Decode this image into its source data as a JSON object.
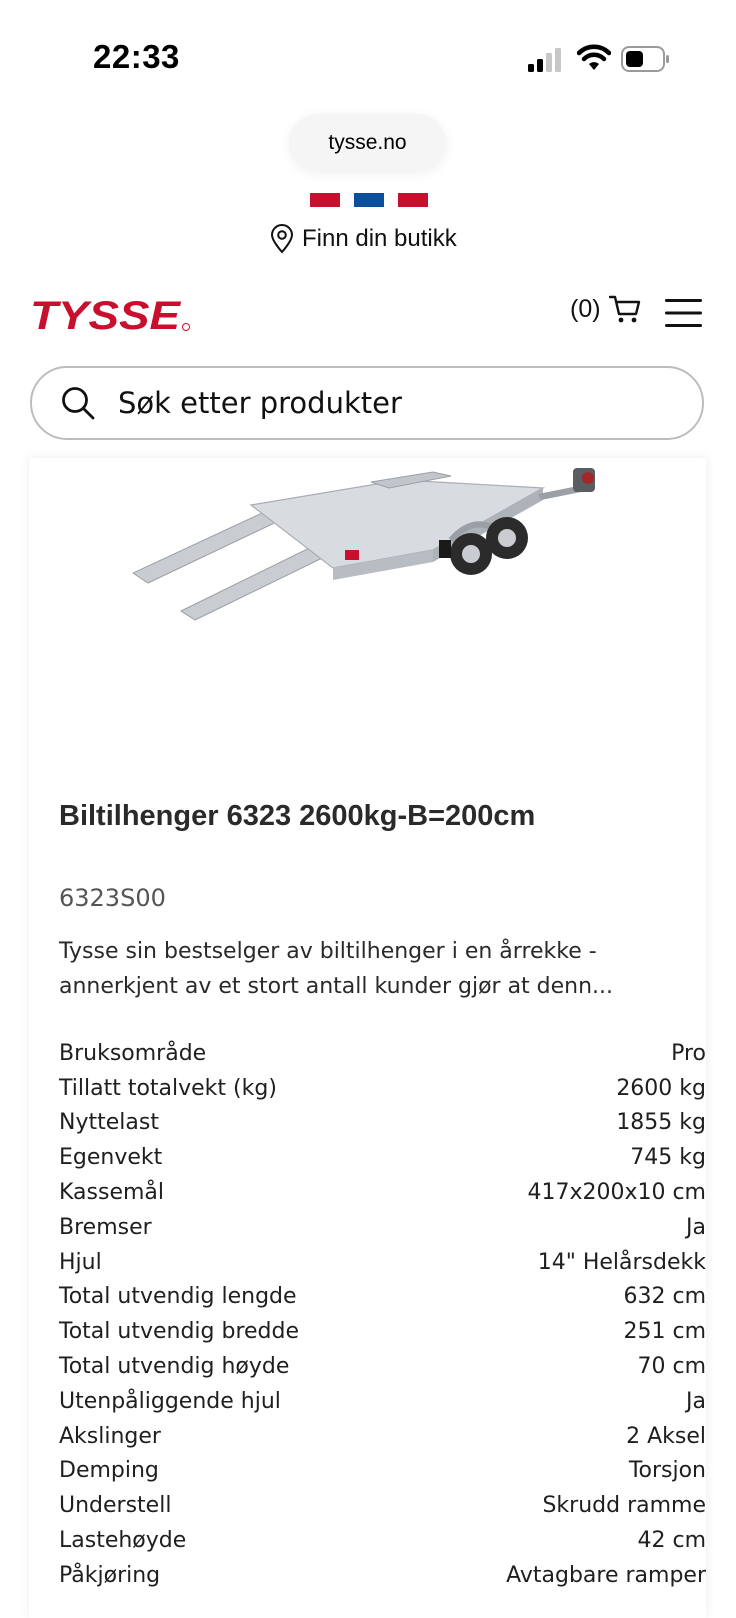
{
  "status_bar": {
    "time": "22:33"
  },
  "browser": {
    "url": "tysse.no"
  },
  "colors": {
    "brand_red": "#c8102e",
    "flag_blue": "#0b4f9c"
  },
  "store_finder": {
    "label": "Finn din butikk",
    "icon": "location-pin-icon"
  },
  "header": {
    "logo": "TYSSE",
    "cart_count": "(0)",
    "cart_icon": "shopping-cart-icon",
    "menu_icon": "hamburger-menu-icon"
  },
  "search": {
    "placeholder": "Søk etter produkter",
    "icon": "search-icon"
  },
  "product": {
    "title": "Biltilhenger 6323 2600kg-B=200cm",
    "sku": "6323S00",
    "description": "Tysse sin bestselger av biltilhenger i en årrekke - annerkjent av et stort antall kunder gjør at denn...",
    "specs": [
      {
        "label": "Bruksområde",
        "value": "Pro"
      },
      {
        "label": "Tillatt totalvekt (kg)",
        "value": "2600 kg"
      },
      {
        "label": "Nyttelast",
        "value": "1855 kg"
      },
      {
        "label": "Egenvekt",
        "value": "745 kg"
      },
      {
        "label": "Kassemål",
        "value": "417x200x10 cm"
      },
      {
        "label": "Bremser",
        "value": "Ja"
      },
      {
        "label": "Hjul",
        "value": "14\" Helårsdekk"
      },
      {
        "label": "Total utvendig lengde",
        "value": "632 cm"
      },
      {
        "label": "Total utvendig bredde",
        "value": "251 cm"
      },
      {
        "label": "Total utvendig høyde",
        "value": "70 cm"
      },
      {
        "label": "Utenpåliggende hjul",
        "value": "Ja"
      },
      {
        "label": "Akslinger",
        "value": "2 Aksel"
      },
      {
        "label": "Demping",
        "value": "Torsjon"
      },
      {
        "label": "Understell",
        "value": "Skrudd ramme"
      },
      {
        "label": "Lastehøyde",
        "value": "42 cm"
      },
      {
        "label": "Påkjøring",
        "value": "Avtagbare ramper"
      }
    ]
  }
}
